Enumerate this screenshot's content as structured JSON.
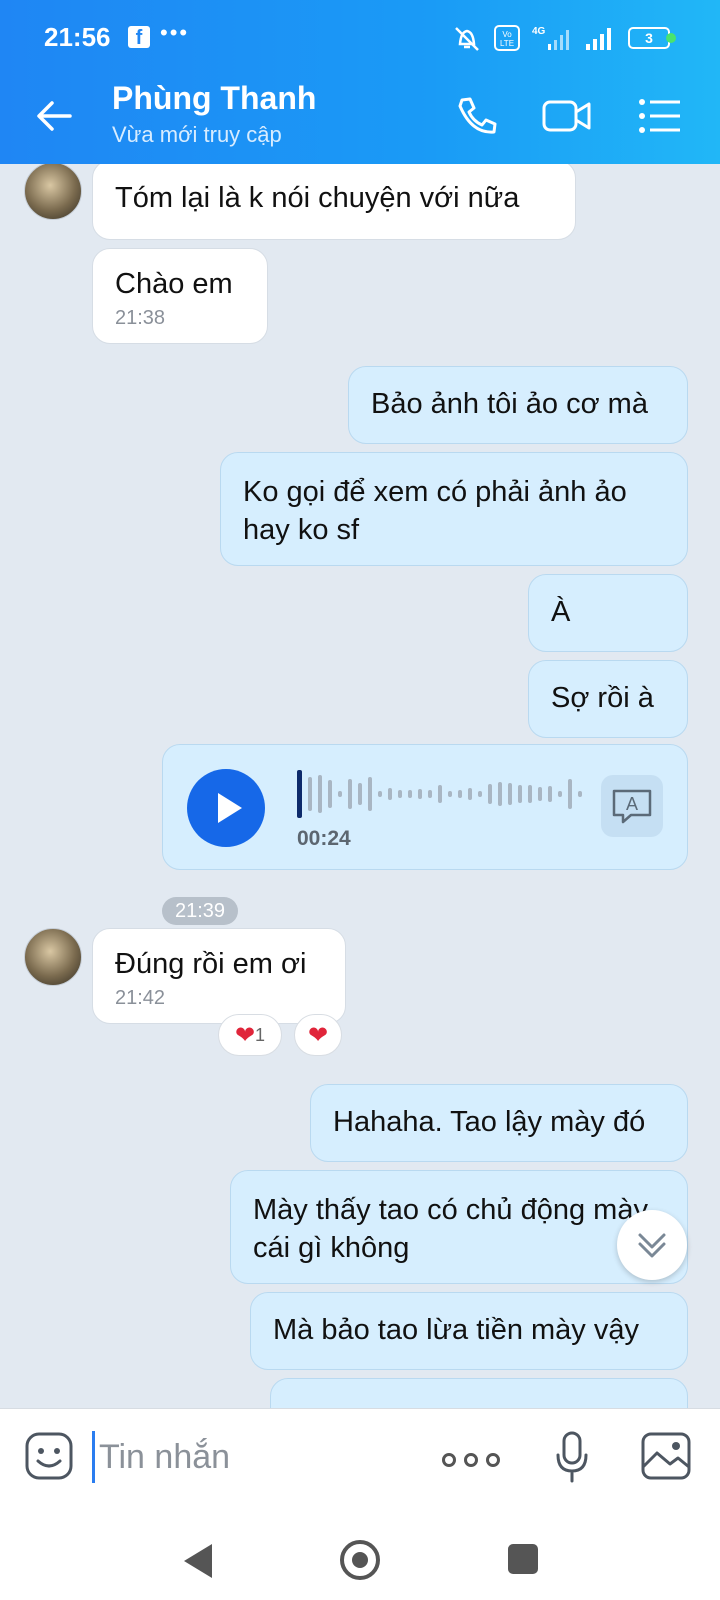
{
  "status_bar": {
    "time": "21:56",
    "battery": "3"
  },
  "header": {
    "contact_name": "Phùng Thanh",
    "contact_status": "Vừa mới truy cập"
  },
  "messages": [
    {
      "side": "in",
      "text": "Tóm lại là k nói chuyện với nữa"
    },
    {
      "side": "in",
      "text": "Chào em",
      "time": "21:38"
    },
    {
      "side": "out",
      "text": "Bảo ảnh tôi ảo cơ mà"
    },
    {
      "side": "out",
      "text": "Ko gọi để xem có phải ảnh ảo hay ko sf"
    },
    {
      "side": "out",
      "text": "À"
    },
    {
      "side": "out",
      "text": "Sợ rồi à"
    },
    {
      "side": "out",
      "type": "voice",
      "duration": "00:24"
    },
    {
      "type": "timestamp",
      "text": "21:39"
    },
    {
      "side": "in",
      "text": "Đúng rồi em ơi",
      "time": "21:42",
      "reactions": [
        {
          "icon": "heart",
          "count": "1"
        },
        {
          "icon": "heart"
        }
      ]
    },
    {
      "side": "out",
      "text": "Hahaha. Tao lậy mày đó"
    },
    {
      "side": "out",
      "text": "Mày thấy tao có chủ động mày cái gì không"
    },
    {
      "side": "out",
      "text": "Mà bảo tao lừa tiền mày vậy"
    }
  ],
  "composer": {
    "placeholder": "Tin nhắn"
  },
  "colors": {
    "header": "#1f86f4",
    "outgoing_bubble": "#d6eefe",
    "incoming_bubble": "#ffffff",
    "play_button": "#1668e8",
    "background": "#e2e9f1"
  }
}
